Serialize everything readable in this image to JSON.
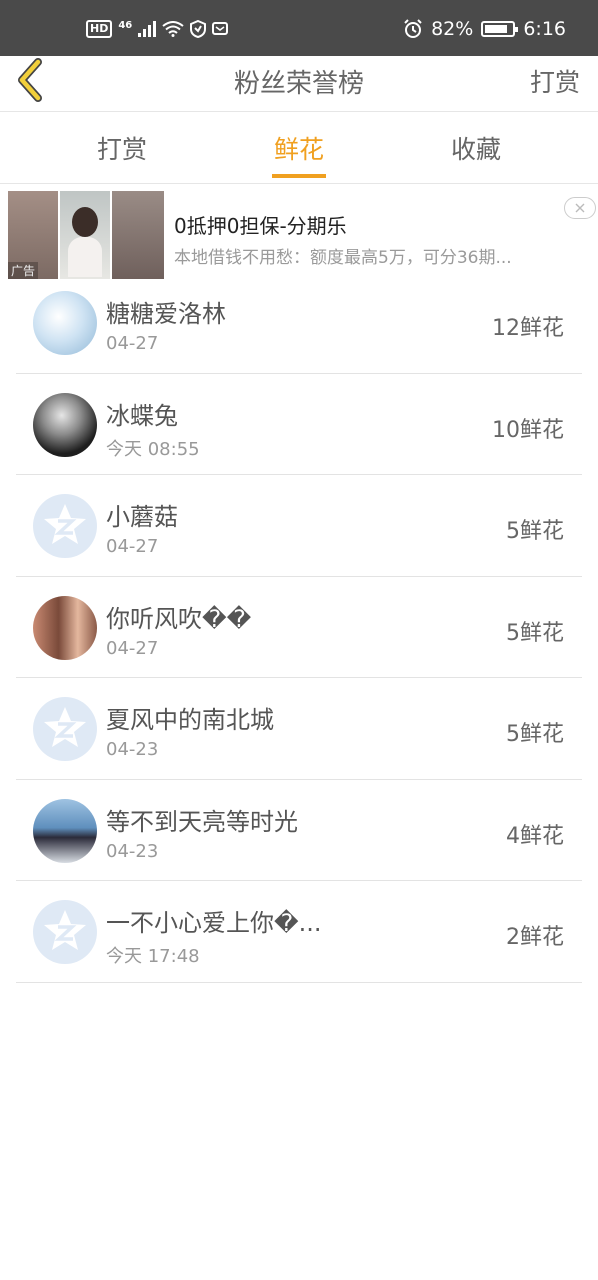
{
  "status_bar": {
    "hd": "HD",
    "network": "46",
    "battery_percent": "82%",
    "battery_level": 0.82,
    "time": "6:16"
  },
  "header": {
    "title": "粉丝荣誉榜",
    "action": "打赏",
    "back_icon": "chevron-left-icon"
  },
  "tabs": {
    "items": [
      {
        "label": "打赏"
      },
      {
        "label": "鲜花"
      },
      {
        "label": "收藏"
      }
    ],
    "active_index": 1,
    "accent_color": "#f0a020"
  },
  "ad": {
    "tag": "广告",
    "title": "0抵押0担保-分期乐",
    "description": "本地借钱不用愁：额度最高5万，可分36期...",
    "close_icon": "close-icon"
  },
  "list": [
    {
      "name": "糖糖爱洛林",
      "time": "04-27",
      "count": "12鲜花",
      "avatar": "photo-light-blue"
    },
    {
      "name": "冰蝶兔",
      "time": "今天 08:55",
      "count": "10鲜花",
      "avatar": "photo-dark"
    },
    {
      "name": "小蘑菇",
      "time": "04-27",
      "count": "5鲜花",
      "avatar": "default"
    },
    {
      "name": "你听风吹��",
      "time": "04-27",
      "count": "5鲜花",
      "avatar": "photo-couple"
    },
    {
      "name": "夏风中的南北城",
      "time": "04-23",
      "count": "5鲜花",
      "avatar": "default"
    },
    {
      "name": "等不到天亮等时光",
      "time": "04-23",
      "count": "4鲜花",
      "avatar": "photo-sea"
    },
    {
      "name": "一不小心爱上你�...",
      "time": "今天 17:48",
      "count": "2鲜花",
      "avatar": "default"
    }
  ]
}
